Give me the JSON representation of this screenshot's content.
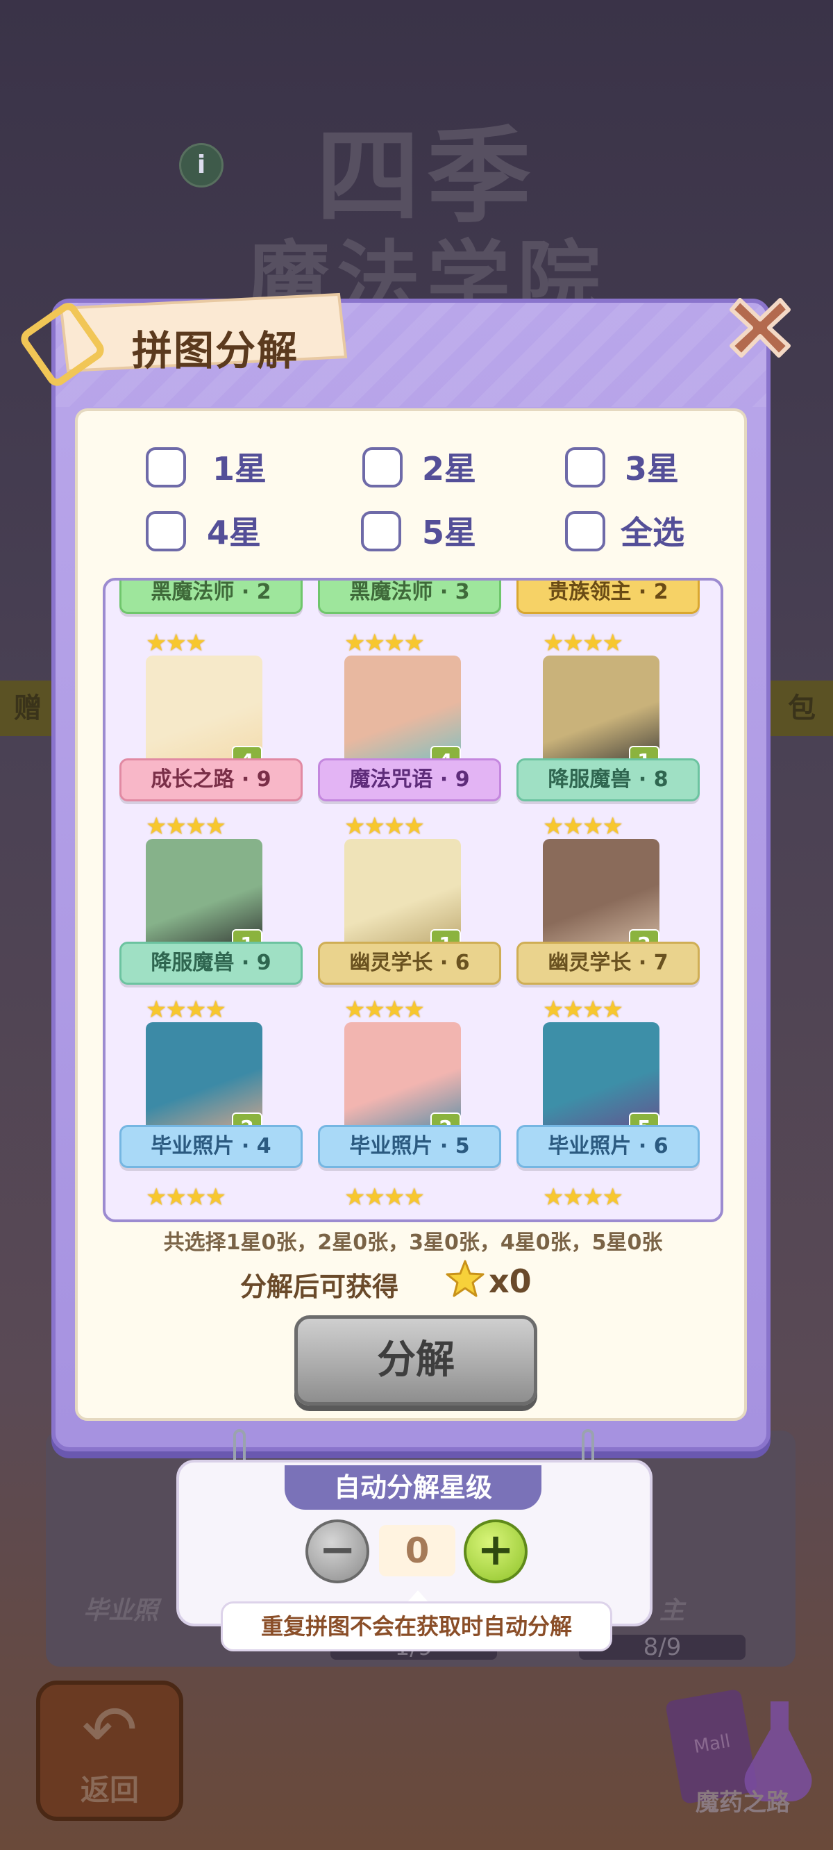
{
  "background": {
    "title_line1": "四季",
    "title_line2": "魔法学院",
    "info_icon": "i",
    "left_tab": "赠",
    "right_tab": "包",
    "card_left_label": "毕业照",
    "card_right_label": "主",
    "progress_left": "1/9",
    "progress_right": "8/9",
    "back_button_label": "返回",
    "potion_label": "魔药之路"
  },
  "modal": {
    "title": "拼图分解",
    "close_icon": "close-icon"
  },
  "filters": [
    {
      "label": "1星",
      "checked": false
    },
    {
      "label": "2星",
      "checked": false
    },
    {
      "label": "3星",
      "checked": false
    },
    {
      "label": "4星",
      "checked": false
    },
    {
      "label": "5星",
      "checked": false
    },
    {
      "label": "全选",
      "checked": false
    }
  ],
  "cards": [
    {
      "name": "黑魔法师 · 2",
      "stars": 0,
      "count": "",
      "ribbon": "green",
      "partial": true
    },
    {
      "name": "黑魔法师 · 3",
      "stars": 0,
      "count": "",
      "ribbon": "green",
      "partial": true
    },
    {
      "name": "贵族领主 · 2",
      "stars": 0,
      "count": "",
      "ribbon": "yellow",
      "partial": true
    },
    {
      "name": "成长之路 · 9",
      "stars": 3,
      "count": "4",
      "ribbon": "pink",
      "art": [
        "#f6e9c9",
        "#f3d9a8"
      ]
    },
    {
      "name": "魔法咒语 · 9",
      "stars": 4,
      "count": "4",
      "ribbon": "purple",
      "art": [
        "#e8b8a0",
        "#6fc1c4"
      ]
    },
    {
      "name": "降服魔兽 · 8",
      "stars": 4,
      "count": "1",
      "ribbon": "mint",
      "art": [
        "#c9b27a",
        "#333333"
      ]
    },
    {
      "name": "降服魔兽 · 9",
      "stars": 4,
      "count": "1",
      "ribbon": "mint",
      "art": [
        "#86b28a",
        "#2a2a2a"
      ]
    },
    {
      "name": "幽灵学长 · 6",
      "stars": 4,
      "count": "1",
      "ribbon": "gold",
      "art": [
        "#efe3b8",
        "#b7a168"
      ]
    },
    {
      "name": "幽灵学长 · 7",
      "stars": 4,
      "count": "2",
      "ribbon": "gold",
      "art": [
        "#8a6b5a",
        "#d7bfa8"
      ]
    },
    {
      "name": "毕业照片 · 4",
      "stars": 4,
      "count": "2",
      "ribbon": "blue",
      "art": [
        "#3c8aa6",
        "#e3a98a"
      ]
    },
    {
      "name": "毕业照片 · 5",
      "stars": 4,
      "count": "2",
      "ribbon": "blue",
      "art": [
        "#f2b5b0",
        "#4a8aa6"
      ]
    },
    {
      "name": "毕业照片 · 6",
      "stars": 4,
      "count": "5",
      "ribbon": "blue",
      "art": [
        "#3d8fa8",
        "#6a4a8a"
      ]
    }
  ],
  "summary": "共选择1星0张，2星0张，3星0张，4星0张，5星0张",
  "reward": {
    "label": "分解后可获得",
    "icon": "star-icon",
    "count": "x0"
  },
  "decompose_button": "分解",
  "auto": {
    "title": "自动分解星级",
    "level": "0",
    "minus_icon": "minus-icon",
    "plus_icon": "plus-icon",
    "note": "重复拼图不会在获取时自动分解"
  }
}
